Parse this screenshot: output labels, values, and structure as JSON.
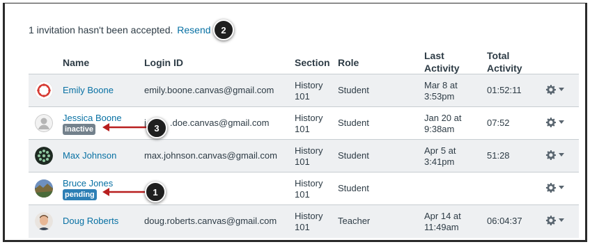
{
  "notice": {
    "text": "1 invitation hasn't been accepted.",
    "resend_label": "Resend"
  },
  "callouts": [
    "1",
    "2",
    "3"
  ],
  "columns": {
    "name": "Name",
    "login": "Login ID",
    "section": "Section",
    "role": "Role",
    "last_activity_1": "Last",
    "last_activity_2": "Activity",
    "total_activity_1": "Total",
    "total_activity_2": "Activity"
  },
  "users": [
    {
      "name": "Emily Boone",
      "badge": "",
      "login": "emily.boone.canvas@gmail.com",
      "section_1": "History",
      "section_2": "101",
      "role": "Student",
      "activity_1": "Mar 8 at",
      "activity_2": "3:53pm",
      "total": "01:52:11",
      "avatar": "pattern-red-icon"
    },
    {
      "name": "Jessica Boone",
      "badge": "inactive",
      "login_prefix": "j",
      "login": ".doe.canvas@gmail.com",
      "section_1": "History",
      "section_2": "101",
      "role": "Student",
      "activity_1": "Jan 20 at",
      "activity_2": "9:38am",
      "total": "07:52",
      "avatar": "default-person-icon"
    },
    {
      "name": "Max Johnson",
      "badge": "",
      "login": "max.johnson.canvas@gmail.com",
      "section_1": "History",
      "section_2": "101",
      "role": "Student",
      "activity_1": "Apr 5 at",
      "activity_2": "3:41pm",
      "total": "51:28",
      "avatar": "pattern-green-icon"
    },
    {
      "name": "Bruce Jones",
      "badge": "pending",
      "login": "",
      "section_1": "History",
      "section_2": "101",
      "role": "Student",
      "activity_1": "",
      "activity_2": "",
      "total": "",
      "avatar": "landscape-photo-icon"
    },
    {
      "name": "Doug Roberts",
      "badge": "",
      "login": "doug.roberts.canvas@gmail.com",
      "section_1": "History",
      "section_2": "101",
      "role": "Teacher",
      "activity_1": "Apr 14 at",
      "activity_2": "11:49am",
      "total": "06:04:37",
      "avatar": "face-photo-icon"
    }
  ],
  "colors": {
    "link": "#0770a3",
    "inactive_badge": "#73818c",
    "pending_badge": "#2d7fb5",
    "arrow": "#b81f1f"
  }
}
